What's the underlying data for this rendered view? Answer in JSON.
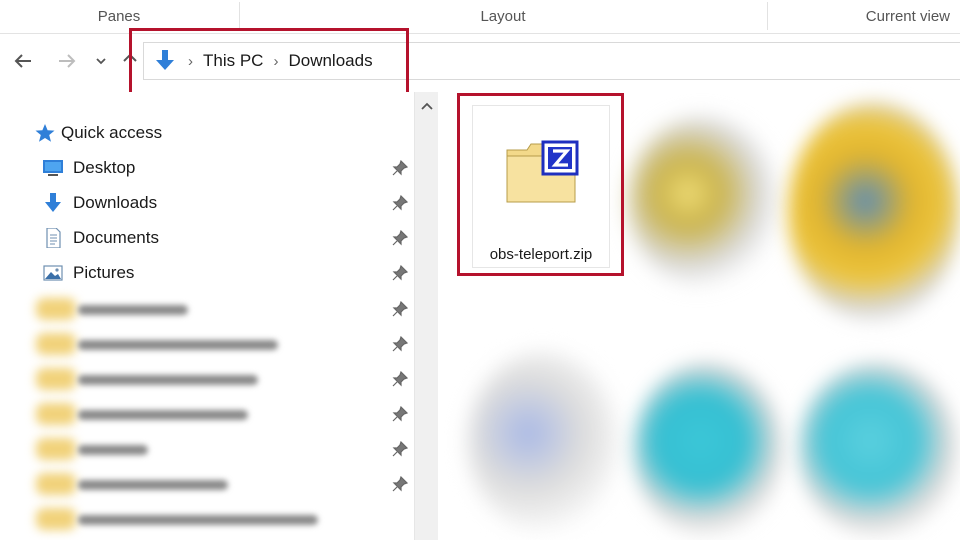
{
  "ribbon": {
    "groups": [
      "Panes",
      "Layout",
      "Current view"
    ]
  },
  "nav": {
    "back_icon": "arrow-left-icon",
    "forward_icon": "arrow-right-icon",
    "recent_icon": "chevron-down-icon",
    "up_icon": "arrow-up-icon"
  },
  "address": {
    "location_icon": "download-arrow-icon",
    "crumbs": [
      "This PC",
      "Downloads"
    ]
  },
  "sidebar": {
    "quick_access": "Quick access",
    "items": [
      {
        "label": "Desktop",
        "icon": "desktop-icon"
      },
      {
        "label": "Downloads",
        "icon": "download-arrow-icon"
      },
      {
        "label": "Documents",
        "icon": "document-icon"
      },
      {
        "label": "Pictures",
        "icon": "picture-icon"
      }
    ]
  },
  "content": {
    "selected_file": {
      "name": "obs-teleport.zip",
      "icon": "zip-folder-icon"
    }
  },
  "colors": {
    "highlight": "#b5122c",
    "accent_blue": "#2f7fd8"
  }
}
